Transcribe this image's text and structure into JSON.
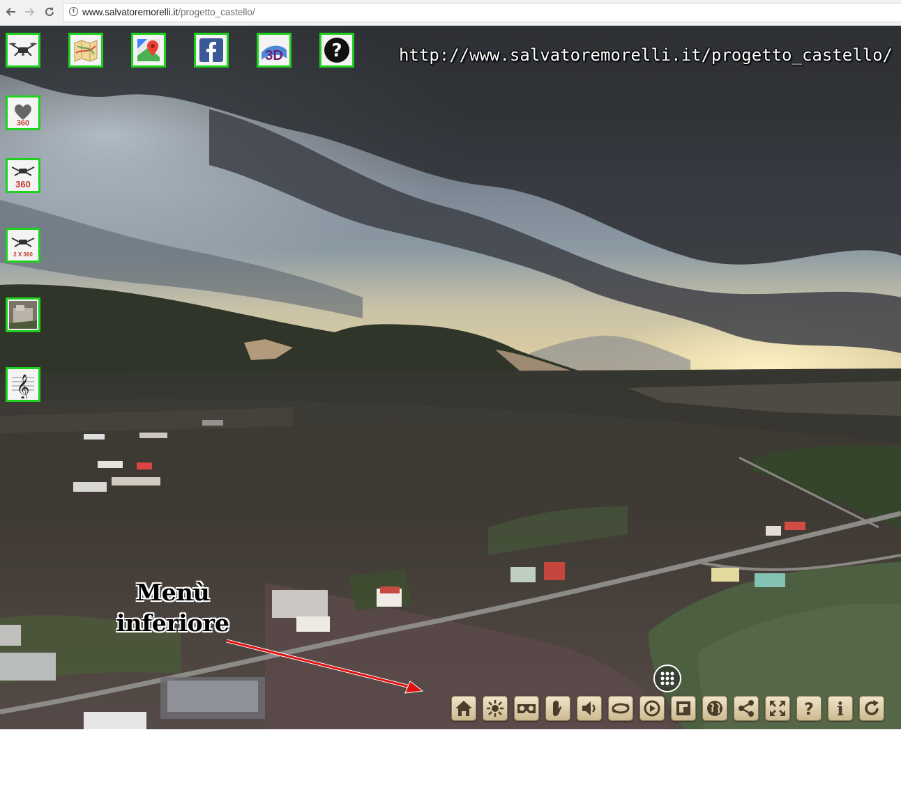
{
  "browser": {
    "back_icon": "arrow-left-icon",
    "forward_icon": "arrow-right-icon",
    "reload_icon": "reload-icon",
    "url_host": "www.salvatoremorelli.it",
    "url_path": "/progetto_castello/"
  },
  "overlay": {
    "site_url": "http://www.salvatoremorelli.it/progetto_castello/",
    "menu_label_line1": "Menù",
    "menu_label_line2": "inferiore"
  },
  "top_icons": [
    {
      "name": "drone-icon"
    },
    {
      "name": "map-icon"
    },
    {
      "name": "google-maps-icon"
    },
    {
      "name": "facebook-icon"
    },
    {
      "name": "3d-icon",
      "label": "3D"
    },
    {
      "name": "help-icon",
      "label": "?"
    }
  ],
  "side_icons": [
    {
      "name": "heart-360-icon",
      "label": "360"
    },
    {
      "name": "drone-360-icon",
      "label": "360"
    },
    {
      "name": "drone-2x360-icon",
      "label": "2 X 360"
    },
    {
      "name": "photo-thumbnail-icon"
    },
    {
      "name": "music-icon"
    }
  ],
  "toolbar": [
    {
      "name": "home-icon"
    },
    {
      "name": "gyroscope-icon"
    },
    {
      "name": "vr-icon"
    },
    {
      "name": "hand-icon"
    },
    {
      "name": "sound-icon"
    },
    {
      "name": "autorotate-icon"
    },
    {
      "name": "rotate-360-icon"
    },
    {
      "name": "floorplan-icon"
    },
    {
      "name": "globe-icon"
    },
    {
      "name": "share-icon"
    },
    {
      "name": "fullscreen-icon"
    },
    {
      "name": "help-icon",
      "label": "?"
    },
    {
      "name": "info-icon",
      "label": "i"
    },
    {
      "name": "reload-icon"
    }
  ],
  "colors": {
    "tile_border": "#1fd11f",
    "toolbar_button": "#e2d4b2",
    "arrow": "#e01010"
  }
}
